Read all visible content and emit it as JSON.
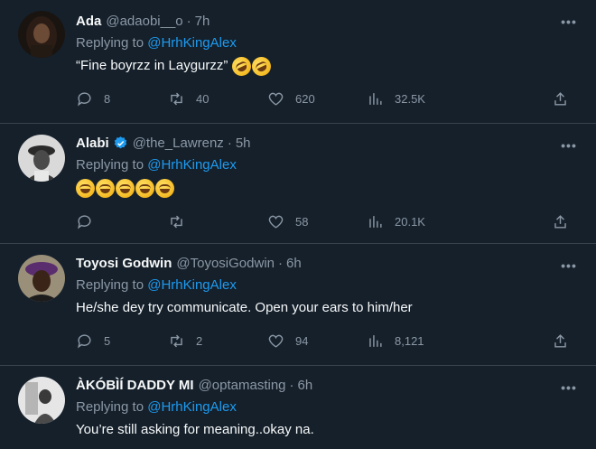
{
  "tweets": [
    {
      "name": "Ada",
      "handle": "@adaobi__o",
      "time": "7h",
      "verified": false,
      "replying_prefix": "Replying to ",
      "replying_to": "@HrhKingAlex",
      "text": "“Fine boyrzz in Laygurzz” ",
      "emojis": [
        "rolling-on-floor-laughing",
        "rolling-on-floor-laughing"
      ],
      "replies": "8",
      "retweets": "40",
      "likes": "620",
      "views": "32.5K"
    },
    {
      "name": "Alabi",
      "handle": "@the_Lawrenz",
      "time": "5h",
      "verified": true,
      "replying_prefix": "Replying to ",
      "replying_to": "@HrhKingAlex",
      "text": "",
      "emojis": [
        "tears-of-joy",
        "grinning-sweat",
        "grinning-sweat",
        "tears-of-joy",
        "tears-of-joy"
      ],
      "replies": "",
      "retweets": "",
      "likes": "58",
      "views": "20.1K"
    },
    {
      "name": "Toyosi Godwin",
      "handle": "@ToyosiGodwin",
      "time": "6h",
      "verified": false,
      "replying_prefix": "Replying to ",
      "replying_to": "@HrhKingAlex",
      "text": "He/she dey try communicate. Open your ears to him/her",
      "emojis": [],
      "replies": "5",
      "retweets": "2",
      "likes": "94",
      "views": "8,121"
    },
    {
      "name": "ÀKÓBÌÍ DADDY MI",
      "handle": "@optamasting",
      "time": "6h",
      "verified": false,
      "replying_prefix": "Replying to ",
      "replying_to": "@HrhKingAlex",
      "text": "You’re still asking for meaning..okay na.",
      "emojis": [],
      "replies": "",
      "retweets": "",
      "likes": "",
      "views": ""
    }
  ],
  "separator": "·",
  "more_label": "•••",
  "colors": {
    "background": "#15202b",
    "divider": "#38444d",
    "secondary_text": "#8b98a5",
    "accent": "#1d9bf0"
  }
}
